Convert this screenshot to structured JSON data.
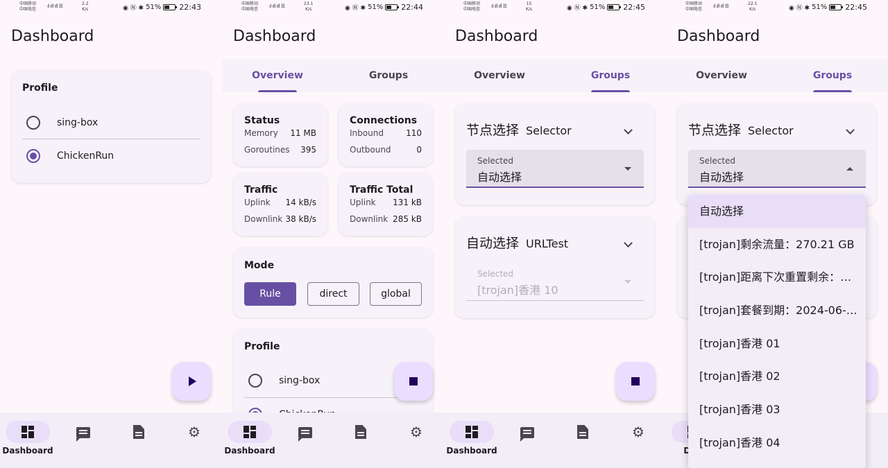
{
  "screens": [
    {
      "carrier1": "中国移动",
      "carrier2": "中国电信",
      "speed": "2.2",
      "speed_unit": "K/s",
      "battery": "51%",
      "time": "22:43",
      "title": "Dashboard",
      "profile": {
        "title": "Profile",
        "items": [
          {
            "label": "sing-box",
            "selected": false
          },
          {
            "label": "ChickenRun",
            "selected": true
          }
        ]
      },
      "fab_icon": "play-icon"
    },
    {
      "carrier1": "中国移动",
      "carrier2": "中国电信",
      "speed": "23.1",
      "speed_unit": "K/s",
      "battery": "51%",
      "time": "22:44",
      "title": "Dashboard",
      "tabs": [
        "Overview",
        "Groups"
      ],
      "active_tab": 0,
      "status": {
        "title": "Status",
        "rows": [
          {
            "k": "Memory",
            "v": "11 MB"
          },
          {
            "k": "Goroutines",
            "v": "395"
          }
        ]
      },
      "connections": {
        "title": "Connections",
        "rows": [
          {
            "k": "Inbound",
            "v": "110"
          },
          {
            "k": "Outbound",
            "v": "0"
          }
        ]
      },
      "traffic": {
        "title": "Traffic",
        "rows": [
          {
            "k": "Uplink",
            "v": "14 kB/s"
          },
          {
            "k": "Downlink",
            "v": "38 kB/s"
          }
        ]
      },
      "traffic_total": {
        "title": "Traffic Total",
        "rows": [
          {
            "k": "Uplink",
            "v": "131 kB"
          },
          {
            "k": "Downlink",
            "v": "285 kB"
          }
        ]
      },
      "mode": {
        "title": "Mode",
        "options": [
          "Rule",
          "direct",
          "global"
        ],
        "selected": "Rule"
      },
      "profile": {
        "title": "Profile",
        "items": [
          {
            "label": "sing-box",
            "selected": false
          },
          {
            "label": "ChickenRun",
            "selected": true
          }
        ]
      },
      "fab_icon": "stop-icon"
    },
    {
      "carrier1": "中国移动",
      "carrier2": "中国电信",
      "speed": "15",
      "speed_unit": "K/s",
      "battery": "51%",
      "time": "22:45",
      "title": "Dashboard",
      "tabs": [
        "Overview",
        "Groups"
      ],
      "active_tab": 1,
      "groups": [
        {
          "name": "节点选择",
          "type": "Selector",
          "field_label": "Selected",
          "value": "自动选择",
          "enabled": true
        },
        {
          "name": "自动选择",
          "type": "URLTest",
          "field_label": "Selected",
          "value": "[trojan]香港 10",
          "enabled": false
        }
      ],
      "fab_icon": "stop-icon"
    },
    {
      "carrier1": "中国移动",
      "carrier2": "中国电信",
      "speed": "22.1",
      "speed_unit": "K/s",
      "battery": "51%",
      "time": "22:45",
      "title": "Dashboard",
      "tabs": [
        "Overview",
        "Groups"
      ],
      "active_tab": 1,
      "groups": [
        {
          "name": "节点选择",
          "type": "Selector",
          "field_label": "Selected",
          "value": "自动选择",
          "enabled": true
        }
      ],
      "menu": [
        "自动选择",
        "[trojan]剩余流量：270.21 GB",
        "[trojan]距离下次重置剩余：…",
        "[trojan]套餐到期：2024-06-…",
        "[trojan]香港 01",
        "[trojan]香港 02",
        "[trojan]香港 03",
        "[trojan]香港 04"
      ],
      "menu_selected": 0
    }
  ],
  "nav": {
    "dashboard_label": "Dashboard",
    "dashboard_label_cut": "Dasl"
  },
  "colors": {
    "accent": "#6750a4",
    "surface": "#fdf7fc",
    "card": "#f7f2fa",
    "fab": "#eaddff"
  }
}
